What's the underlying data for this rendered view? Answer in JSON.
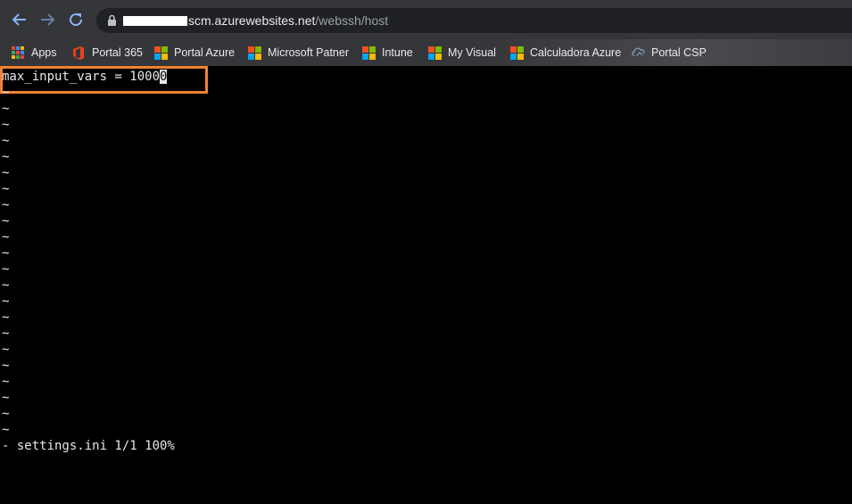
{
  "browser": {
    "url_domain": "scm.azurewebsites.net",
    "url_path": "/webssh/host"
  },
  "bookmarks": [
    {
      "label": "Apps",
      "icon": "apps-grid-icon"
    },
    {
      "label": "Portal 365",
      "icon": "office-icon"
    },
    {
      "label": "Portal Azure",
      "icon": "microsoft-icon"
    },
    {
      "label": "Microsoft Patner",
      "icon": "microsoft-icon"
    },
    {
      "label": "Intune",
      "icon": "microsoft-icon"
    },
    {
      "label": "My Visual",
      "icon": "microsoft-icon"
    },
    {
      "label": "Calculadora Azure",
      "icon": "microsoft-icon"
    },
    {
      "label": "Portal CSP",
      "icon": "csp-icon"
    }
  ],
  "terminal": {
    "line_text": "max_input_vars = 1000",
    "cursor_char": "0",
    "tilde": "~",
    "status": "- settings.ini 1/1 100%"
  },
  "colors": {
    "highlight": "#f08231",
    "terminal_bg": "#000000",
    "terminal_fg": "#e8e8e8"
  }
}
